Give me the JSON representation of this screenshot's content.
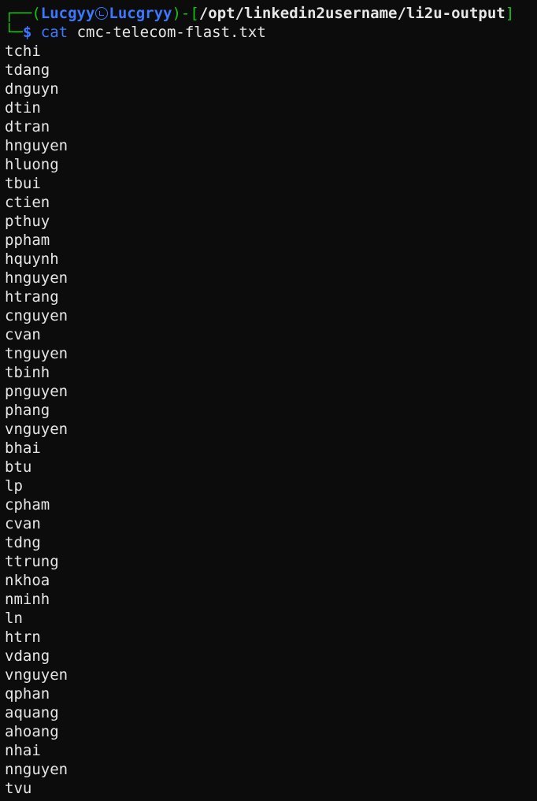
{
  "prompt": {
    "corner_top": "┌──(",
    "user": "Lucgyy",
    "host": "Lucgryy",
    "close_paren": ")-[",
    "cwd": "/opt/linkedin2username/li2u-output",
    "close_bracket": "]",
    "corner_bottom": "└─",
    "dollar": "$",
    "command_name": "cat",
    "command_arg": "cmc-telecom-flast.txt",
    "separator_icon": "kali-skull-icon"
  },
  "output_lines": [
    "tchi",
    "tdang",
    "dnguyn",
    "dtin",
    "dtran",
    "hnguyen",
    "hluong",
    "tbui",
    "ctien",
    "pthuy",
    "ppham",
    "hquynh",
    "hnguyen",
    "htrang",
    "cnguyen",
    "cvan",
    "tnguyen",
    "tbinh",
    "pnguyen",
    "phang",
    "vnguyen",
    "bhai",
    "btu",
    "lp",
    "cpham",
    "cvan",
    "tdng",
    "ttrung",
    "nkhoa",
    "nminh",
    "ln",
    "htrn",
    "vdang",
    "vnguyen",
    "qphan",
    "aquang",
    "ahoang",
    "nhai",
    "nnguyen",
    "tvu"
  ],
  "colors": {
    "background": "#0c0c0c",
    "foreground": "#e6e6e6",
    "prompt_green": "#16c60c",
    "prompt_blue": "#3b78ff"
  }
}
